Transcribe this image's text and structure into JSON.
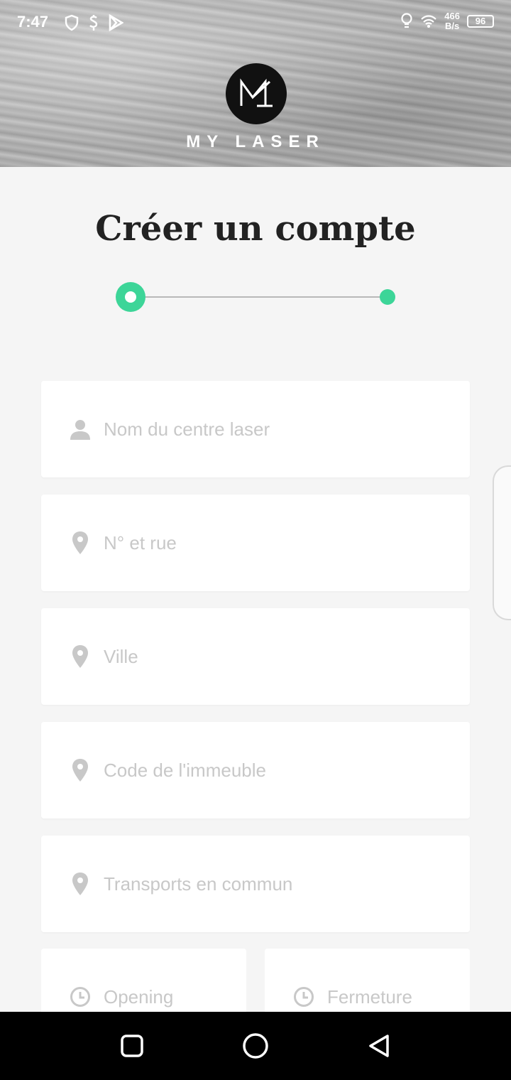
{
  "status_bar": {
    "time": "7:47",
    "net_speed_value": "466",
    "net_speed_unit": "B/s",
    "battery": "96"
  },
  "brand": {
    "name": "MY LASER"
  },
  "page": {
    "title": "Créer un compte"
  },
  "stepper": {
    "current_step": 1,
    "total_steps": 2,
    "color": "#3dd598"
  },
  "form": {
    "fields": [
      {
        "placeholder": "Nom du centre laser",
        "icon": "person-icon"
      },
      {
        "placeholder": "N° et rue",
        "icon": "location-pin-icon"
      },
      {
        "placeholder": "Ville",
        "icon": "location-pin-icon"
      },
      {
        "placeholder": "Code de l'immeuble",
        "icon": "location-pin-icon"
      },
      {
        "placeholder": "Transports en commun",
        "icon": "location-pin-icon"
      }
    ],
    "opening": {
      "placeholder": "Opening",
      "icon": "clock-icon"
    },
    "closing": {
      "placeholder": "Fermeture",
      "icon": "clock-icon"
    }
  }
}
